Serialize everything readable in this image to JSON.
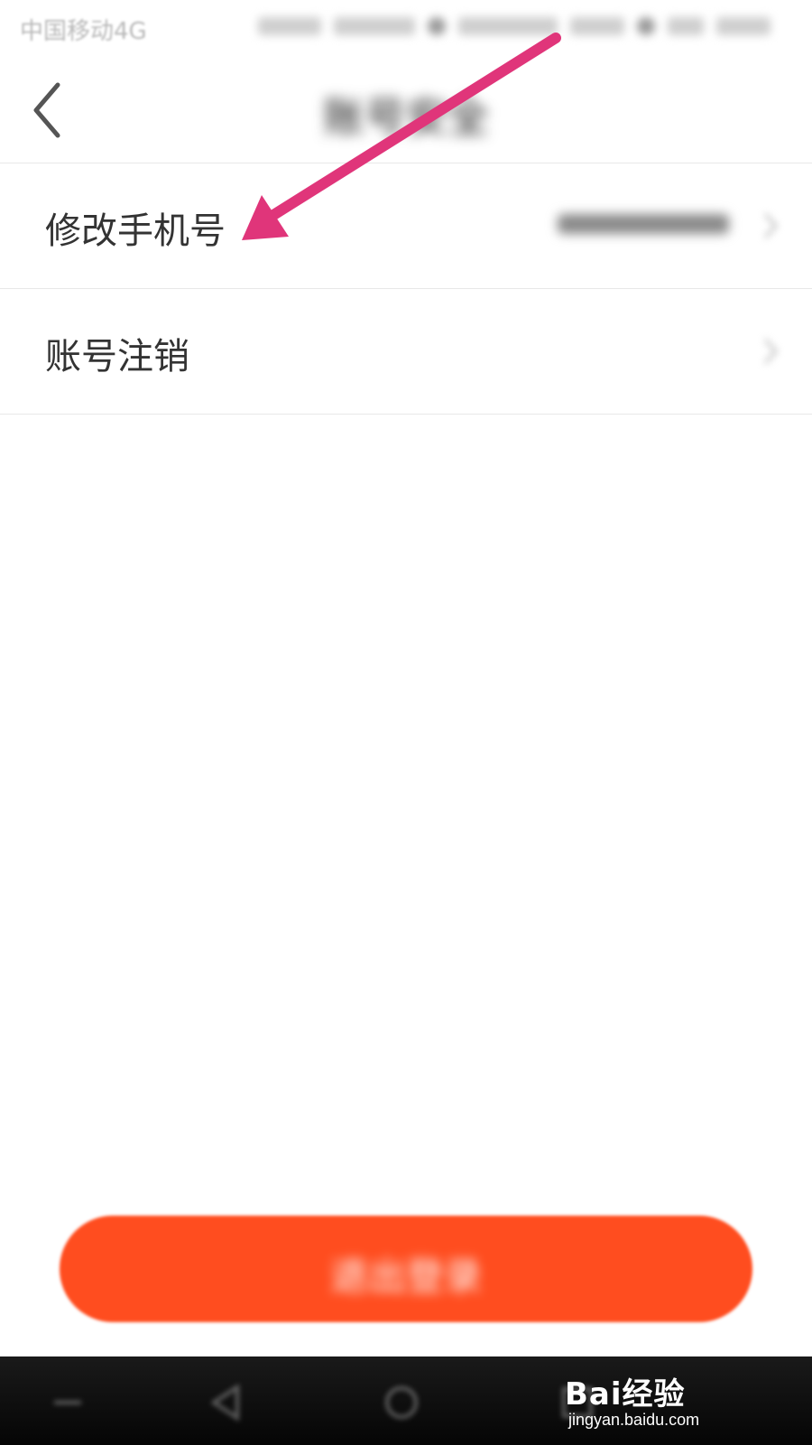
{
  "status_bar": {
    "carrier": "中国移动4G"
  },
  "nav": {
    "title": "账号安全"
  },
  "menu": {
    "items": [
      {
        "label": "修改手机号",
        "value": ""
      },
      {
        "label": "账号注销"
      }
    ]
  },
  "logout": {
    "label": "退出登录"
  },
  "colors": {
    "accent": "#ff4d1f",
    "annotation_arrow": "#e0357a"
  },
  "watermark": {
    "logo_text": "Bai经验",
    "url": "jingyan.baidu.com"
  }
}
